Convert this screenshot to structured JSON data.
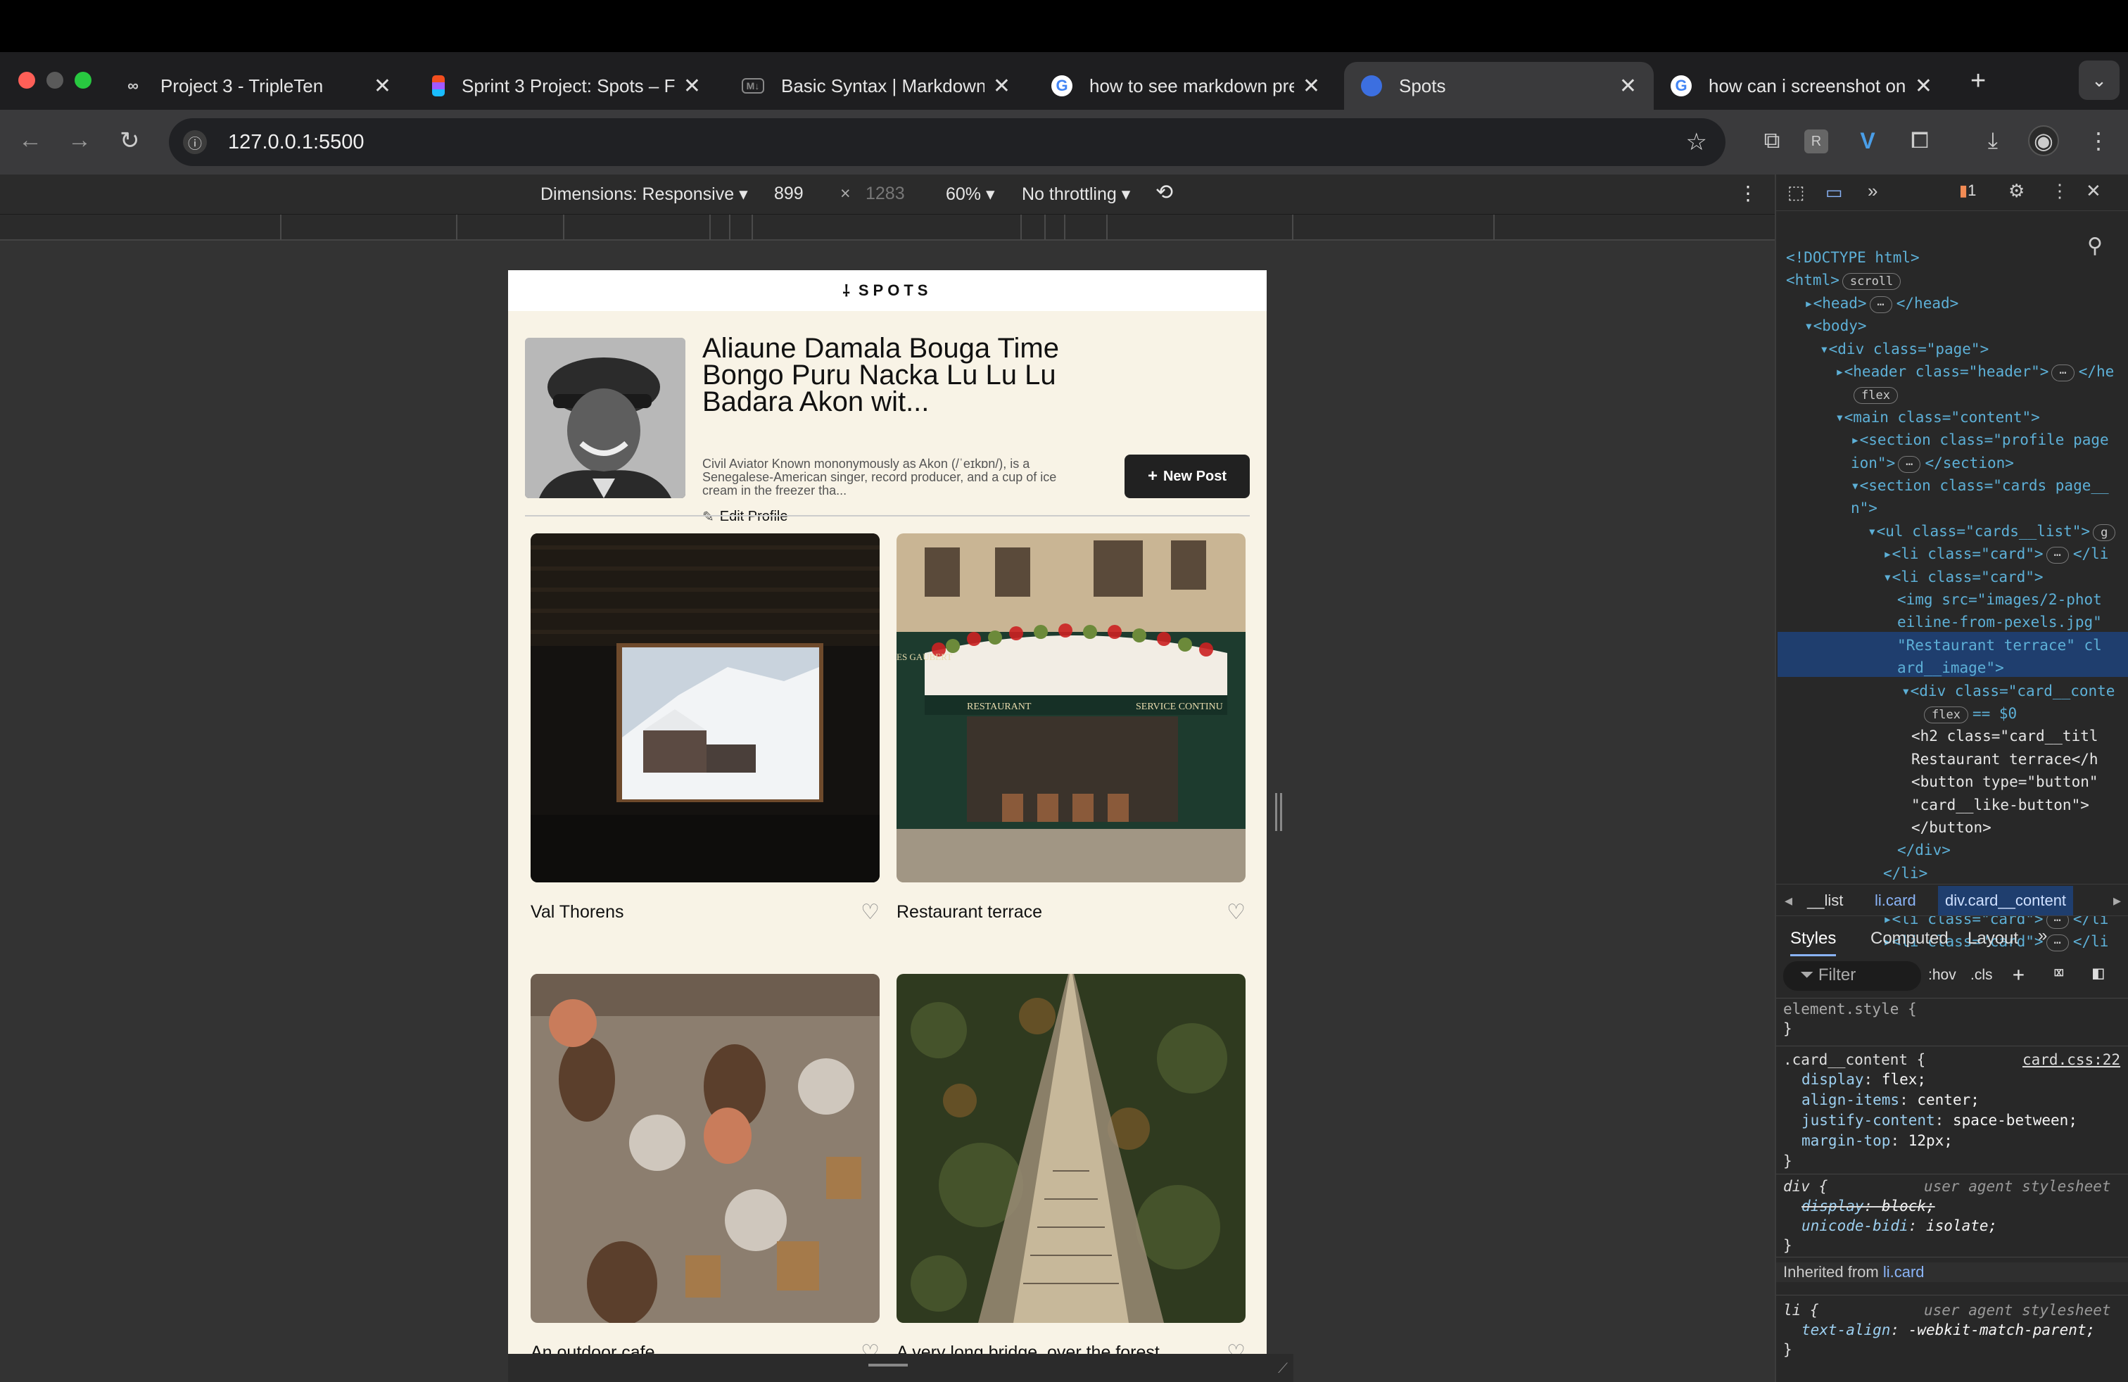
{
  "browser": {
    "tabs": [
      {
        "title": "Project 3 - TripleTen",
        "icon": "tripleten-icon"
      },
      {
        "title": "Sprint 3 Project: Spots – F",
        "icon": "figma-icon"
      },
      {
        "title": "Basic Syntax | Markdown G",
        "icon": "markdown-icon"
      },
      {
        "title": "how to see markdown prev",
        "icon": "google-icon"
      },
      {
        "title": "Spots",
        "icon": "spots-icon"
      },
      {
        "title": "how can i screenshot on a",
        "icon": "google-icon"
      }
    ],
    "url": "127.0.0.1:5500"
  },
  "device_toolbar": {
    "dimensions": "Dimensions: Responsive",
    "width": "899",
    "times": "×",
    "height": "1283",
    "zoom": "60%",
    "throttling": "No throttling"
  },
  "site": {
    "logo": "SPOTS",
    "logo_mark": "⸸",
    "profile": {
      "name": "Aliaune Damala Bouga Time Bongo Puru Nacka Lu Lu Lu Badara Akon wit...",
      "description": "Civil Aviator Known mononymously as Akon (/ˈeɪkɒn/), is a Senegalese-American singer, record producer, and a cup of ice cream in the freezer tha...",
      "edit_label": "Edit Profile",
      "new_post_label": "New Post"
    },
    "cards": [
      {
        "title": "Val Thorens"
      },
      {
        "title": "Restaurant terrace"
      },
      {
        "title": "An outdoor cafe"
      },
      {
        "title": "A very long bridge, over the forest..."
      }
    ],
    "restaurant_sign": "RESTAURANT",
    "restaurant_sign2": "SERVICE CONTINU",
    "restaurant_side": "ES GAUBERT"
  },
  "devtools": {
    "issues_count": "1",
    "dom_lines": [
      {
        "t": "<!DOCTYPE html>"
      },
      {
        "t": "<html>",
        "pill": "scroll"
      },
      {
        "t": "▸<head>",
        "pill": "⋯",
        "tail": "</head>"
      },
      {
        "t": "▾<body>"
      },
      {
        "t": "▾<div class=\"page\">"
      },
      {
        "t": "▸<header class=\"header\">",
        "pill": "⋯",
        "tail": "</he"
      },
      {
        "t": "",
        "pill": "flex"
      },
      {
        "t": "▾<main class=\"content\">"
      },
      {
        "t": "▸<section class=\"profile page"
      },
      {
        "t": "ion\">",
        "pill": "⋯",
        "tail": "</section>"
      },
      {
        "t": "▾<section class=\"cards page__"
      },
      {
        "t": "n\">"
      },
      {
        "t": "▾<ul class=\"cards__list\">",
        "pill": "g"
      },
      {
        "t": "▸<li class=\"card\">",
        "pill": "⋯",
        "tail": "</li"
      },
      {
        "t": "▾<li class=\"card\">"
      },
      {
        "t": "<img src=\"images/2-phot"
      },
      {
        "t": "eiline-from-pexels.jpg\""
      },
      {
        "t": "\"Restaurant terrace\" cl"
      },
      {
        "t": "ard__image\">"
      },
      {
        "t": "▾<div class=\"card__conte"
      },
      {
        "t": "",
        "pill": "flex",
        "tail": "== $0"
      },
      {
        "t": "<h2 class=\"card__titl"
      },
      {
        "t": "Restaurant terrace</h"
      },
      {
        "t": "<button type=\"button\""
      },
      {
        "t": "\"card__like-button\">"
      },
      {
        "t": "</button>"
      },
      {
        "t": "</div>"
      },
      {
        "t": "</li>"
      },
      {
        "t": "▸<li class=\"card\">",
        "pill": "⋯",
        "tail": "</li"
      },
      {
        "t": "▸<li class=\"card\">",
        "pill": "⋯",
        "tail": "</li"
      },
      {
        "t": "▸<li class=\"card\">",
        "pill": "⋯",
        "tail": "</li"
      }
    ],
    "breadcrumbs": [
      "__list",
      "li.card",
      "div.card__content"
    ],
    "panel_tabs": [
      "Styles",
      "Computed",
      "Layout"
    ],
    "filter_placeholder": "Filter",
    "hov": ":hov",
    "cls": ".cls",
    "styles": {
      "element_style": "element.style {",
      "close": "}",
      "rule_selector": ".card__content {",
      "rule_source": "card.css:22",
      "props": [
        {
          "p": "display",
          "v": "flex;"
        },
        {
          "p": "align-items",
          "v": "center;"
        },
        {
          "p": "justify-content",
          "v": "space-between;"
        },
        {
          "p": "margin-top",
          "v": "12px;"
        }
      ],
      "div_selector": "div {",
      "ua_label": "user agent stylesheet",
      "div_props": [
        {
          "p": "display",
          "v": "block;"
        },
        {
          "p": "unicode-bidi",
          "v": "isolate;"
        }
      ],
      "inherited_label": "Inherited from",
      "inherited_from": "li.card",
      "li_selector": "li {",
      "li_props": [
        {
          "p": "text-align",
          "v": "-webkit-match-parent;"
        }
      ]
    }
  }
}
